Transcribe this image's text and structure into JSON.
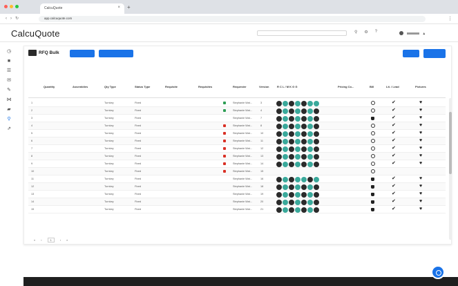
{
  "browser": {
    "tab_title": "CalcuQuote",
    "url": "app.calcuquote.com"
  },
  "app": {
    "logo": "CalcuQuote",
    "search_placeholder": ""
  },
  "page": {
    "title": "RFQ Bulk",
    "btn_primary_1": "",
    "btn_primary_2": "",
    "btn_right_1": "",
    "btn_right_2": "",
    "section_left": "",
    "section_right": "",
    "filters_left": [
      "",
      "",
      "",
      ""
    ],
    "filters_right": [
      "",
      "",
      ""
    ]
  },
  "table": {
    "columns": [
      "Quantity",
      "Assemblies",
      "Qty Type",
      "Status Type",
      "Requisite",
      "Requisites",
      "Requester",
      "Version",
      "R C L / M K G G",
      "Pricing Co...",
      "Bill",
      "Lit. / Lead",
      "Pictures"
    ],
    "status_colors": {
      "green": "#2e9e55",
      "red": "#d93025",
      "none": "transparent"
    },
    "rows": [
      {
        "n": "1",
        "type": "Turnkey",
        "unit": "Fixed",
        "status": "green",
        "req": "Stephanie Wat...",
        "ver": "3",
        "circles": "dtdtdtt",
        "bill": "ring",
        "lit": "check",
        "pic": "heart"
      },
      {
        "n": "2",
        "type": "Turnkey",
        "unit": "Fixed",
        "status": "green",
        "req": "Stephanie Wat...",
        "ver": "4",
        "circles": "dtdtdtd",
        "bill": "ring",
        "lit": "check",
        "pic": "heart"
      },
      {
        "n": "3",
        "type": "Turnkey",
        "unit": "Fixed",
        "status": "none",
        "req": "Stephanie Wat...",
        "ver": "7",
        "circles": "dtdtdtd",
        "bill": "tag",
        "lit": "check",
        "pic": "heart"
      },
      {
        "n": "4",
        "type": "Turnkey",
        "unit": "Fixed",
        "status": "red",
        "req": "Stephanie Wat...",
        "ver": "8",
        "circles": "dtdtdtd",
        "bill": "ring",
        "lit": "check",
        "pic": "heart"
      },
      {
        "n": "5",
        "type": "Turnkey",
        "unit": "Fixed",
        "status": "red",
        "req": "Stephanie Wat...",
        "ver": "10",
        "circles": "dtdtdtd",
        "bill": "ring",
        "lit": "check",
        "pic": "heart"
      },
      {
        "n": "6",
        "type": "Turnkey",
        "unit": "Fixed",
        "status": "red",
        "req": "Stephanie Wat...",
        "ver": "11",
        "circles": "dtdtdtd",
        "bill": "ring",
        "lit": "check",
        "pic": "heart"
      },
      {
        "n": "7",
        "type": "Turnkey",
        "unit": "Fixed",
        "status": "red",
        "req": "Stephanie Wat...",
        "ver": "12",
        "circles": "dtdtdtd",
        "bill": "ring",
        "lit": "check",
        "pic": "heart"
      },
      {
        "n": "8",
        "type": "Turnkey",
        "unit": "Fixed",
        "status": "red",
        "req": "Stephanie Wat...",
        "ver": "13",
        "circles": "dtdtdtd",
        "bill": "ring",
        "lit": "check",
        "pic": "heart"
      },
      {
        "n": "9",
        "type": "Turnkey",
        "unit": "Fixed",
        "status": "red",
        "req": "Stephanie Wat...",
        "ver": "14",
        "circles": "dtdtdtd",
        "bill": "ring",
        "lit": "check",
        "pic": "heart"
      },
      {
        "n": "10",
        "type": "Turnkey",
        "unit": "Fixed",
        "status": "red",
        "req": "Stephanie Wat...",
        "ver": "15",
        "circles": "",
        "bill": "ring",
        "lit": "",
        "pic": ""
      },
      {
        "n": "11",
        "type": "Turnkey",
        "unit": "Fixed",
        "status": "none",
        "req": "Stephanie Wat...",
        "ver": "16",
        "circles": "dtdttdt",
        "bill": "tag",
        "lit": "check",
        "pic": "heart"
      },
      {
        "n": "12",
        "type": "Turnkey",
        "unit": "Fixed",
        "status": "none",
        "req": "Stephanie Wat...",
        "ver": "18",
        "circles": "dtdtdtd",
        "bill": "tag",
        "lit": "check",
        "pic": "heart"
      },
      {
        "n": "13",
        "type": "Turnkey",
        "unit": "Fixed",
        "status": "none",
        "req": "Stephanie Wat...",
        "ver": "19",
        "circles": "dtdtdtd",
        "bill": "tag",
        "lit": "check",
        "pic": "heart"
      },
      {
        "n": "14",
        "type": "Turnkey",
        "unit": "Fixed",
        "status": "none",
        "req": "Stephanie Wat...",
        "ver": "20",
        "circles": "dtdtdtd",
        "bill": "tag",
        "lit": "check",
        "pic": "heart"
      },
      {
        "n": "15",
        "type": "Turnkey",
        "unit": "Fixed",
        "status": "none",
        "req": "Stephanie Wat...",
        "ver": "21",
        "circles": "dtdtdtd",
        "bill": "tag",
        "lit": "check",
        "pic": "heart"
      }
    ]
  },
  "pagination": {
    "pages": [
      "«",
      "‹",
      "1",
      "›",
      "»"
    ],
    "info": ""
  },
  "colors": {
    "accent": "#1a73e8",
    "teal": "#3aa99b",
    "dark": "#2b2b2b",
    "footer": "#1f1f1f"
  },
  "icons": {
    "sidebar": [
      "clock-icon",
      "dashboard-icon",
      "list-icon",
      "mail-icon",
      "tool-icon",
      "share-icon",
      "folder-icon",
      "search-icon",
      "chart-icon"
    ]
  }
}
